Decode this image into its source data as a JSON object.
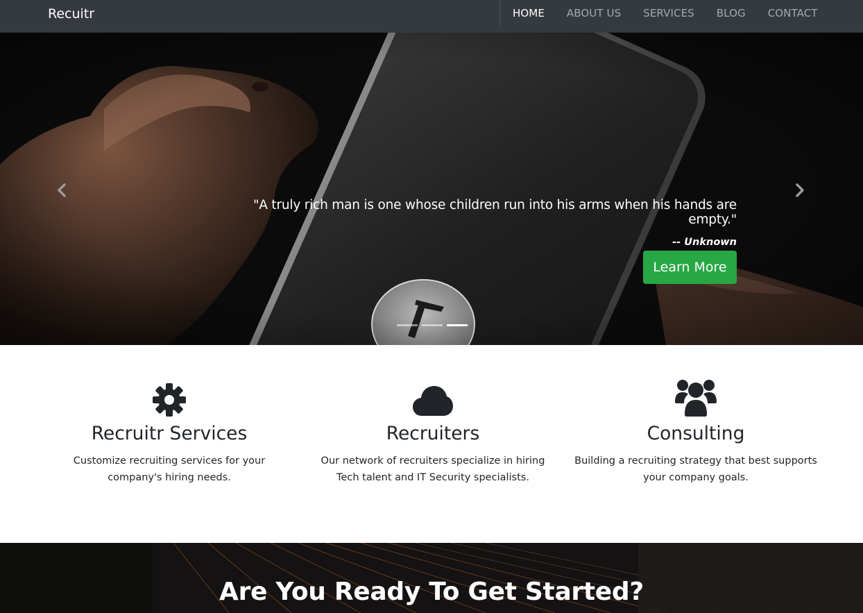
{
  "navbar": {
    "brand": "Recuitr",
    "links": [
      {
        "label": "HOME",
        "active": true
      },
      {
        "label": "ABOUT US",
        "active": false
      },
      {
        "label": "SERVICES",
        "active": false
      },
      {
        "label": "BLOG",
        "active": false
      },
      {
        "label": "CONTACT",
        "active": false
      }
    ]
  },
  "hero": {
    "quote": "\"A truly rich man is one whose children run into his arms when his hands are empty.\"",
    "author_prefix": "-- ",
    "author": "Unknown",
    "button_label": "Learn More",
    "prev_icon": "chevron-left-icon",
    "next_icon": "chevron-right-icon",
    "slides_count": 3,
    "active_slide": 3
  },
  "features": [
    {
      "icon": "gear-icon",
      "title": "Recruitr Services",
      "text": "Customize recruiting services for your company's hiring needs."
    },
    {
      "icon": "cloud-icon",
      "title": "Recruiters",
      "text": "Our network of recruiters specialize in hiring Tech talent and IT Security specialists."
    },
    {
      "icon": "users-icon",
      "title": "Consulting",
      "text": "Building a recruiting strategy that best supports your company goals."
    }
  ],
  "cta": {
    "title": "Are You Ready To Get Started?"
  },
  "colors": {
    "navbar_bg": "#343a40",
    "accent_green": "#28a745",
    "text_dark": "#212529"
  }
}
